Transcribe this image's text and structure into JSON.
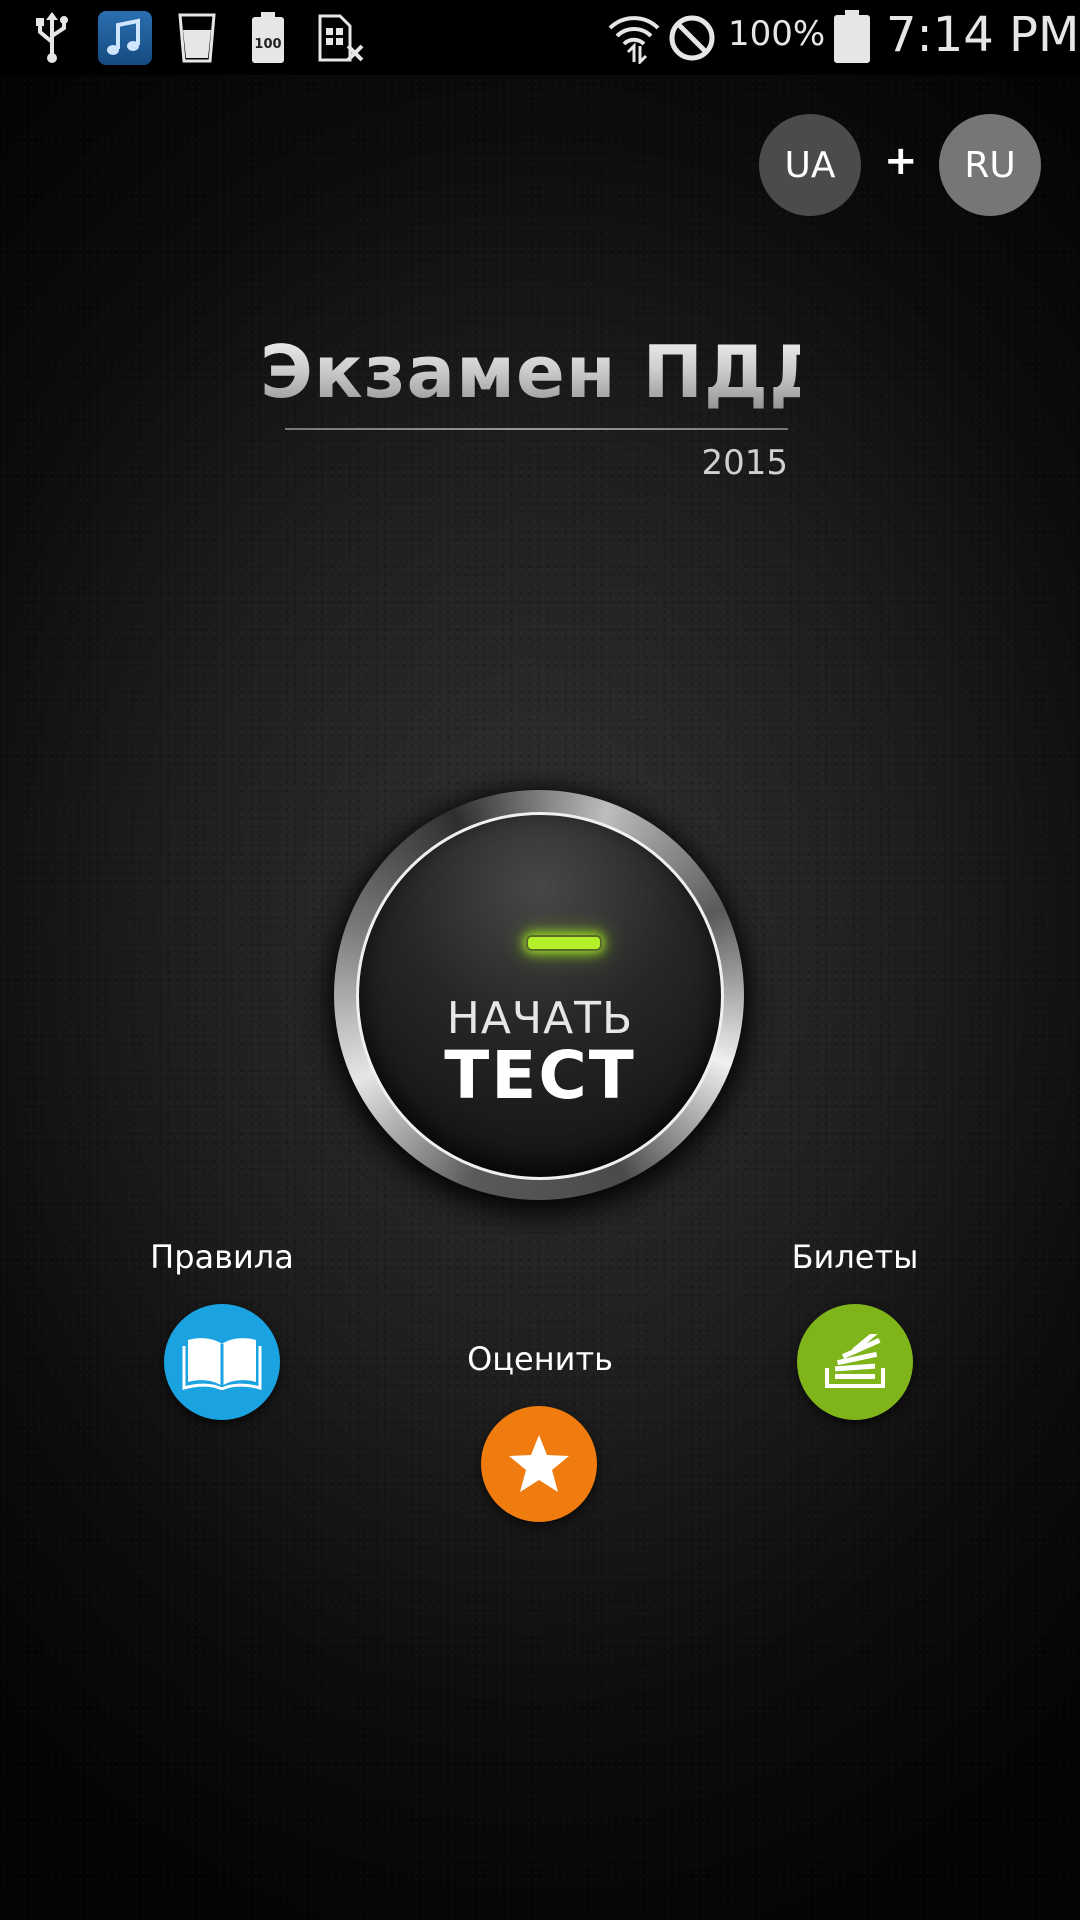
{
  "status_bar": {
    "icons": [
      "usb-icon",
      "music-icon",
      "water-glass-icon",
      "battery-100-icon",
      "sim-off-icon",
      "wifi-icon",
      "do-not-disturb-icon",
      "battery-icon"
    ],
    "battery_percent": "100%",
    "time": "7:14 PM"
  },
  "language": {
    "ua_label": "UA",
    "plus": "+",
    "ru_label": "RU"
  },
  "header": {
    "title": "Экзамен ПДД",
    "year": "2015"
  },
  "start_button": {
    "line1": "НАЧАТЬ",
    "line2": "ТЕСТ",
    "indicator_color": "#b4f02a"
  },
  "menu": {
    "rules": {
      "label": "Правила",
      "icon": "book-icon",
      "color": "#1aa3e0"
    },
    "rate": {
      "label": "Оценить",
      "icon": "star-icon",
      "color": "#f07b0e"
    },
    "tickets": {
      "label": "Билеты",
      "icon": "stack-icon",
      "color": "#7fb41a"
    }
  }
}
